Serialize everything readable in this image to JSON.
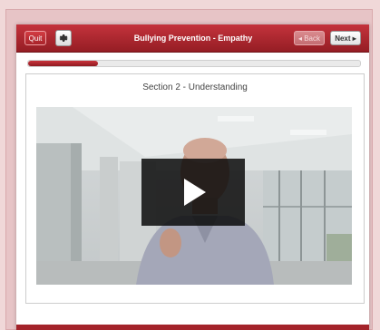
{
  "header": {
    "quit_label": "Quit",
    "title": "Bullying Prevention - Empathy",
    "back_label": "◂ Back",
    "next_label": "Next ▸"
  },
  "progress": {
    "fraction": 0.21
  },
  "content": {
    "section_title": "Section 2 - Understanding"
  },
  "icons": {
    "settings": "gear-icon",
    "play": "play-icon"
  },
  "colors": {
    "brand_red": "#a8232a",
    "background_pink": "#e7c4c6"
  }
}
